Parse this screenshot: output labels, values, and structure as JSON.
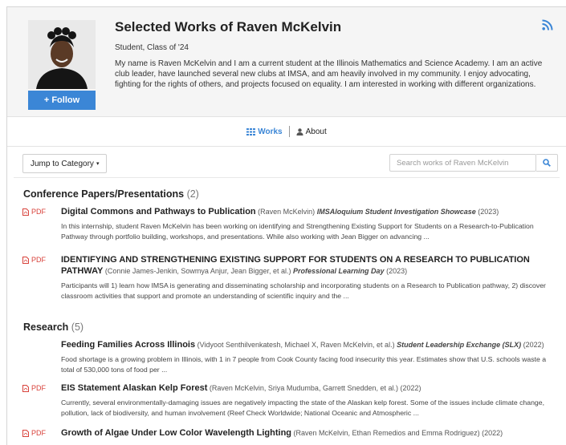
{
  "profile": {
    "title": "Selected Works of Raven McKelvin",
    "subtitle": "Student, Class of '24",
    "bio": "My name is Raven McKelvin and I am a current student at the Illinois Mathematics and Science Academy. I am an active club leader, have launched several new clubs at IMSA, and am heavily involved in my community. I enjoy advocating, fighting for the rights of others, and projects focused on equality. I am interested in working with different organizations.",
    "follow_label": "+ Follow"
  },
  "tabs": [
    {
      "label": "Works",
      "icon": "grid-icon",
      "active": true
    },
    {
      "label": "About",
      "icon": "person-icon",
      "active": false
    }
  ],
  "toolbar": {
    "jump_label": "Jump to Category",
    "jump_caret": "▾",
    "search_placeholder": "Search works of Raven McKelvin"
  },
  "sections": [
    {
      "title": "Conference Papers/Presentations",
      "count": "(2)",
      "items": [
        {
          "pdf": "PDF",
          "title": "Digital Commons and Pathways to Publication",
          "authors": "(Raven McKelvin)",
          "venue": "IMSAloquium Student Investigation Showcase",
          "year": "(2023)",
          "description": "In this internship, student Raven McKelvin has been working on identifying and Strengthening Existing Support for Students on a Research-to-Publication Pathway through portfolio building, workshops, and presentations. While also working with Jean Bigger on advancing ..."
        },
        {
          "pdf": "PDF",
          "title": "IDENTIFYING AND STRENGTHENING EXISTING SUPPORT FOR STUDENTS ON A RESEARCH TO PUBLICATION PATHWAY",
          "authors": "(Connie James-Jenkin, Sowmya Anjur, Jean Bigger, et al.)",
          "venue": "Professional Learning Day",
          "year": "(2023)",
          "description": "Participants will 1) learn how IMSA is generating and disseminating scholarship and incorporating students on a Research to Publication pathway, 2) discover classroom activities that support and promote an understanding of scientific inquiry and the ..."
        }
      ]
    },
    {
      "title": "Research",
      "count": "(5)",
      "items": [
        {
          "pdf": "",
          "title": "Feeding Families Across Illinois",
          "authors": "(Vidyoot Senthilvenkatesh, Michael X, Raven McKelvin, et al.)",
          "venue": "Student Leadership Exchange (SLX)",
          "year": "(2022)",
          "description": "Food shortage is a growing problem in Illinois, with 1 in 7 people from Cook County facing food insecurity this year. Estimates show that U.S. schools waste a total of 530,000 tons of food per ..."
        },
        {
          "pdf": "PDF",
          "title": "EIS Statement Alaskan Kelp Forest",
          "authors": "(Raven McKelvin, Sriya Mudumba, Garrett Snedden, et al.)",
          "venue": "",
          "year": "(2022)",
          "description": "Currently, several environmentally-damaging issues are negatively impacting the state of the Alaskan kelp forest. Some of the issues include climate change, pollution, lack of biodiversity, and human involvement (Reef Check Worldwide; National Oceanic and Atmospheric ..."
        },
        {
          "pdf": "PDF",
          "title": "Growth of Algae Under Low Color Wavelength Lighting",
          "authors": "(Raven McKelvin, Ethan Remedios and Emma Rodriguez)",
          "venue": "",
          "year": "(2022)",
          "description": ""
        }
      ]
    }
  ],
  "colors": {
    "accent": "#3b86d6",
    "pdf": "#d8413a",
    "header_bg": "#f5f5f5"
  },
  "icons": [
    "rss-icon",
    "grid-icon",
    "person-icon",
    "search-icon",
    "pdf-icon"
  ]
}
